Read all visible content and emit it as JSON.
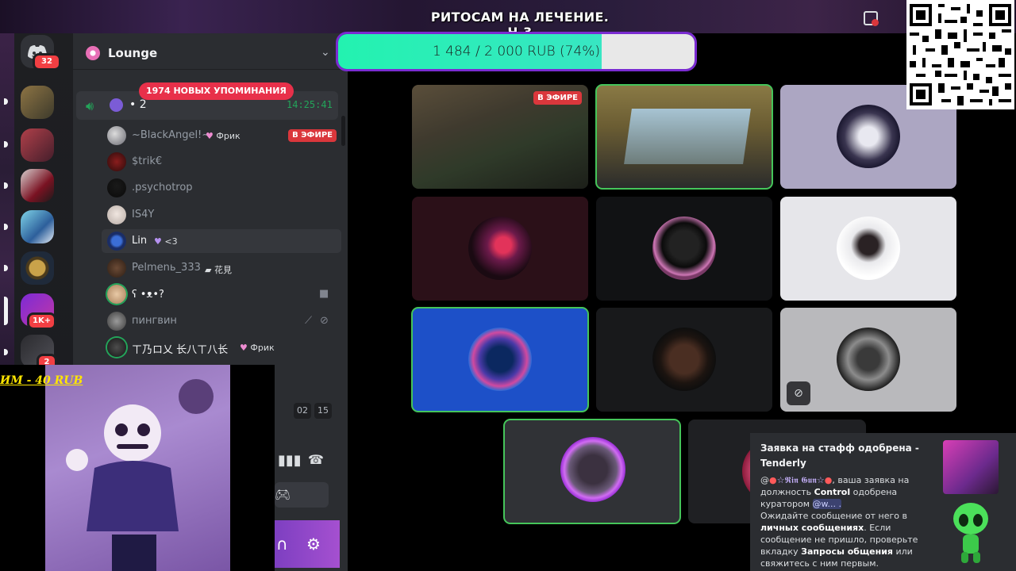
{
  "stream": {
    "title": "РИТОСАМ НА ЛЕЧЕНИЕ. Ч.3"
  },
  "donation": {
    "text": "1 484 / 2 000 RUB (74%)",
    "progress": 0.74
  },
  "servers": [
    {
      "name": "Discord home",
      "badge": "32"
    },
    {
      "name": "server-1"
    },
    {
      "name": "server-2"
    },
    {
      "name": "server-3"
    },
    {
      "name": "server-4"
    },
    {
      "name": "server-5"
    },
    {
      "name": "server-6",
      "badge": "1K+"
    },
    {
      "name": "server-7",
      "badge": "2"
    }
  ],
  "sidebar": {
    "server_name": "Lounge",
    "mentions_pill": "1974 НОВЫХ УПОМИНАНИЯ",
    "voice_channel": {
      "name": "• 2",
      "time": "14:25:41"
    },
    "members": [
      {
        "name": "~BlackAngel!~",
        "tag": "Фрик",
        "live": "В ЭФИРЕ"
      },
      {
        "name": "$trik€"
      },
      {
        "name": ".psychotrop"
      },
      {
        "name": "IS4Y"
      },
      {
        "name": "Lin",
        "tag": "<3"
      },
      {
        "name": "Pelmenь_333",
        "tag": "花見"
      },
      {
        "name": "ʕ •ᴥ•?"
      },
      {
        "name": "пингвин"
      },
      {
        "name": "ㄒ乃ロ乂 长八ㄒ八长",
        "tag": "Фрик"
      }
    ],
    "pager": [
      "02",
      "15"
    ]
  },
  "grid": {
    "live_label": "В ЭФИРЕ"
  },
  "overlay": {
    "text": "ИМ - 40 RUB"
  },
  "notification": {
    "title": "Заявка на стафф одобрена - Tenderly",
    "line1_prefix": "@",
    "line1_name": "☆𝕽𝖎𝖓 𝕲𝖚𝖓☆",
    "line1_rest": ", ваша заявка на должность",
    "role": "Control",
    "line1_end": "одобрена куратором",
    "curator": "@w... .",
    "line2_a": "Ожидайте сообщение от него в",
    "line2_b": "личных сообщениях",
    "line2_c": ". Если сообщение не пришло, проверьте вкладку",
    "line2_d": "Запросы общения",
    "line2_e": "или свяжитесь с ним первым."
  },
  "colors": {
    "accent": "#23a55a",
    "danger": "#da373c",
    "donate_fill": "#23f2b0",
    "sidebar": "#2b2d31"
  }
}
